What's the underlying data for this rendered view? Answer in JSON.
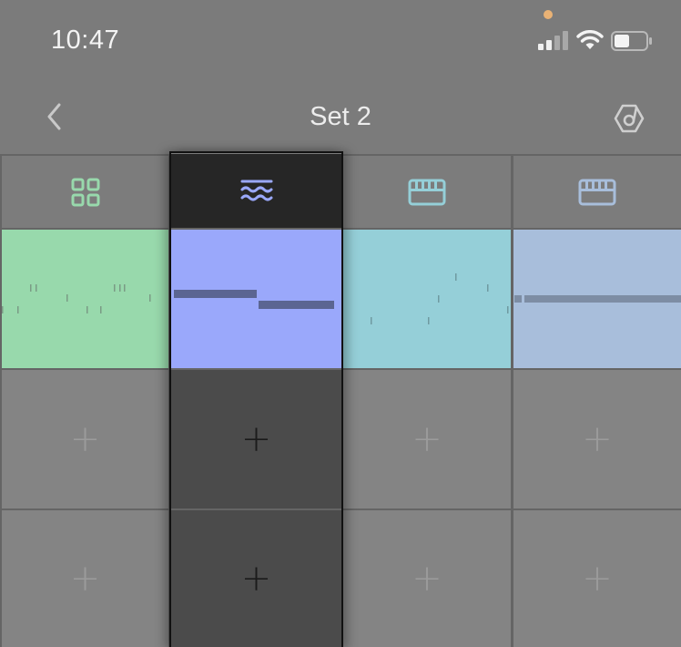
{
  "status_bar": {
    "time": "10:47",
    "icons": [
      "signal-icon",
      "wifi-icon",
      "battery-icon"
    ],
    "privacy_dot_color": "#e9b275"
  },
  "header": {
    "title": "Set 2",
    "back_icon": "chevron-left-icon",
    "app_icon": "ableton-link-icon"
  },
  "tracks": [
    {
      "name": "drum-rack",
      "icon": "drum-grid-icon",
      "color": "#98d9ac",
      "selected": false
    },
    {
      "name": "wavetable",
      "icon": "wave-icon",
      "color": "#9aa8fb",
      "selected": true
    },
    {
      "name": "keys-1",
      "icon": "keyboard-icon",
      "color": "#95cfd8",
      "selected": false
    },
    {
      "name": "keys-2",
      "icon": "keyboard-icon",
      "color": "#a8bedb",
      "selected": false
    }
  ],
  "empty_slot_label": "+",
  "colors": {
    "background": "#7b7b7b",
    "empty_slot": "#848484",
    "selected_empty_slot": "#4b4b4b",
    "selected_header": "#262626"
  }
}
